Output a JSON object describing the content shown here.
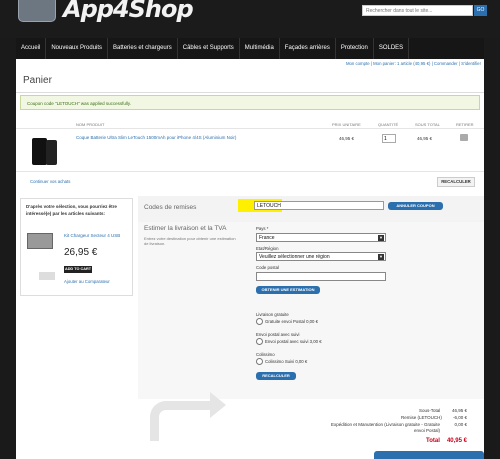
{
  "header": {
    "logo_text": "App4Shop",
    "search_placeholder": "Rechercher dans tout le site...",
    "search_button": "GO"
  },
  "nav": [
    "Accueil",
    "Nouveaux Produits",
    "Batteries et chargeurs",
    "Câbles et Supports",
    "Multimédia",
    "Façades arrières",
    "Protection",
    "SOLDES"
  ],
  "top_links": "Mon compte | Mon panier: 1 article (40,95 €) | Commander | S'identifier",
  "page_title": "Panier",
  "success_message": "Coupon code \"LETOUCH\" was applied successfully.",
  "cart": {
    "headers": {
      "name": "NOM PRODUIT",
      "unit_price": "PRIX UNITAIRE",
      "qty": "QUANTITÉ",
      "subtotal": "SOUS TOTAL",
      "remove": "RETIRER"
    },
    "item": {
      "name": "Coque Batterie Ultra Slim LeTouch 1500mAh pour iPhone 4/4S (Aluminium Noir)",
      "unit_price": "46,95 €",
      "qty": "1",
      "subtotal": "46,95 €"
    },
    "continue_link": "Continuer vos achats",
    "recalc_button": "RECALCULER"
  },
  "suggest": {
    "intro": "D'après votre sélection, vous pourriez être intéressé(e) par les articles suivants:",
    "product_name": "Kit Chargeur Secteur 4 USB",
    "price": "26,95 €",
    "add_button": "ADD TO CART",
    "compare_link": "Ajouter au Comparateur"
  },
  "coupon": {
    "label": "Codes de remises",
    "value": "LETOUCH",
    "button": "ANNULER COUPON"
  },
  "estimate": {
    "label": "Estimer la livraison et la TVA",
    "description": "Entrez votre destination pour obtenir une estimation de livraison.",
    "country_label": "Pays *",
    "country_value": "France",
    "region_label": "Etat/Région",
    "region_value": "Veuillez sélectionner une région",
    "postal_label": "Code postal",
    "estimate_button": "OBTENIR UNE ESTIMATION",
    "options": [
      {
        "group": "Livraison gratuite",
        "option": "Gratuite envoi Postal 0,00 €"
      },
      {
        "group": "Envoi postal avec suivi",
        "option": "Envoi postal avec suivi 3,00 €"
      },
      {
        "group": "Colissimo",
        "option": "Colissimo Suivi 0,00 €"
      }
    ],
    "recalc_button": "RECALCULER"
  },
  "totals": {
    "rows": [
      {
        "label": "Sous-Total",
        "value": "46,95 €"
      },
      {
        "label": "Remise (LETOUCH)",
        "value": "-6,00 €"
      },
      {
        "label": "Expédition et Manutention (Livraison gratuite - Gratuite envoi Postal)",
        "value": "0,00 €"
      }
    ],
    "total_label": "Total",
    "total_value": "40,95 €"
  }
}
